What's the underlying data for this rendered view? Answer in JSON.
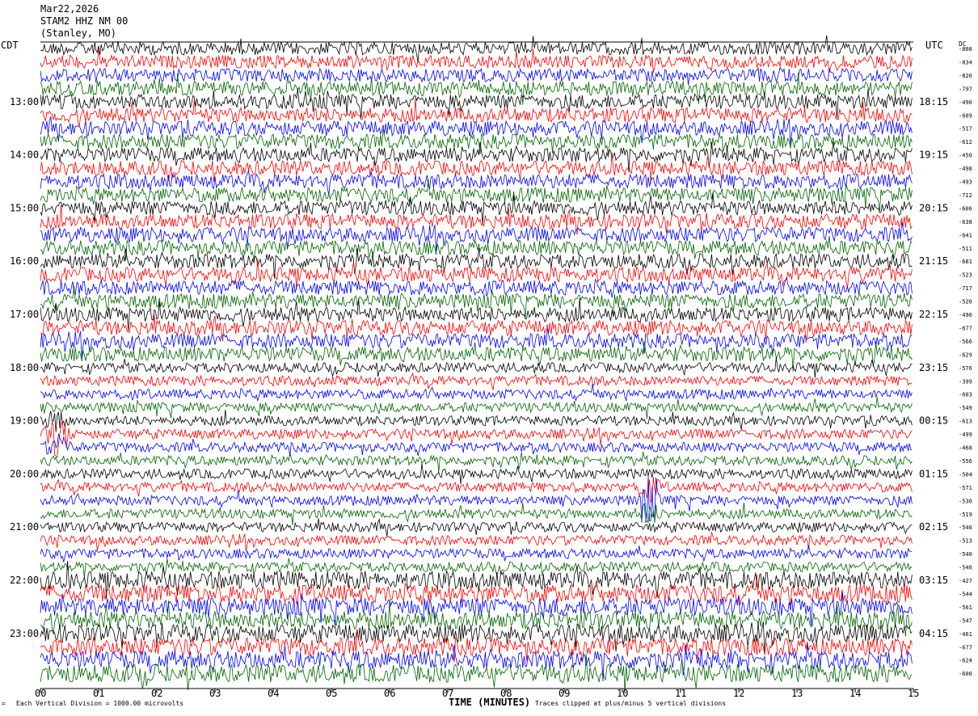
{
  "header": {
    "date": "Mar22,2026",
    "station": "STAM2 HHZ NM 00",
    "location": "(Stanley, MO)"
  },
  "footer": {
    "mark": "=",
    "scale_note": "Each Vertical Division = 1000.00 microvolts",
    "clip_note": "Traces clipped at plus/minus 5 vertical divisions"
  },
  "chart_data": {
    "type": "line",
    "title": "",
    "xlabel": "TIME (MINUTES)",
    "ylabel": "",
    "left_axis_label": "CDT",
    "right_axis_label": "UTC",
    "dc_header": "DC",
    "x_ticks": [
      "00",
      "01",
      "02",
      "03",
      "04",
      "05",
      "06",
      "07",
      "08",
      "09",
      "10",
      "11",
      "12",
      "13",
      "14",
      "15"
    ],
    "xlim": [
      0,
      15
    ],
    "left_hour_labels": [
      "13:00",
      "14:00",
      "15:00",
      "16:00",
      "17:00",
      "18:00",
      "19:00",
      "20:00",
      "21:00",
      "22:00",
      "23:00"
    ],
    "right_hour_labels": [
      "18:15",
      "19:15",
      "20:15",
      "21:15",
      "22:15",
      "23:15",
      "00:15",
      "01:15",
      "02:15",
      "03:15",
      "04:15"
    ],
    "trace_colors": [
      "#000000",
      "#ff0000",
      "#0000ff",
      "#006400"
    ],
    "traces_per_hour": 4,
    "trace_minutes": 15,
    "dc_offsets": [
      -808,
      -834,
      -820,
      -797,
      -490,
      -609,
      -517,
      -612,
      -450,
      -498,
      -493,
      -712,
      -606,
      -638,
      -641,
      -511,
      -681,
      -523,
      -717,
      -520,
      -490,
      -677,
      -566,
      -629,
      -576,
      -399,
      -603,
      -549,
      -613,
      -499,
      -468,
      -556,
      -504,
      -571,
      -530,
      -519,
      -540,
      -513,
      -540,
      -540,
      -427,
      -544,
      -561,
      -547,
      -461,
      -677,
      -624,
      -600
    ],
    "events": [
      {
        "trace": 29,
        "minute": 0.3,
        "label": ""
      },
      {
        "trace": 34,
        "minute": 10.45,
        "label": ""
      }
    ]
  }
}
